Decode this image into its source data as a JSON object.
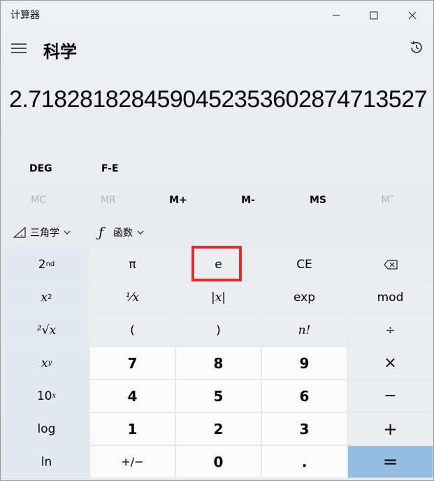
{
  "app_title": "计算器",
  "mode": "科学",
  "display_value": "2.7182818284590452353602874713527",
  "angle_unit": "DEG",
  "fe_label": "F-E",
  "memory": [
    {
      "label": "MC",
      "enabled": false
    },
    {
      "label": "MR",
      "enabled": false
    },
    {
      "label": "M+",
      "enabled": true
    },
    {
      "label": "M-",
      "enabled": true
    },
    {
      "label": "MS",
      "enabled": true
    },
    {
      "label": "M˅",
      "enabled": false
    }
  ],
  "dropdowns": {
    "trig_label": "三角学",
    "func_label": "函数"
  },
  "keys": {
    "second": "2",
    "second_sup": "nd",
    "pi": "π",
    "e": "e",
    "ce": "CE",
    "x_sq": "x",
    "x_sq_sup": "2",
    "reciprocal": "⅟x",
    "abs": "|x|",
    "exp": "exp",
    "mod": "mod",
    "sqrt": "²√x",
    "lparen": "(",
    "rparen": ")",
    "fact": "n!",
    "divide": "÷",
    "x_pow": "x",
    "x_pow_sup": "y",
    "seven": "7",
    "eight": "8",
    "nine": "9",
    "times": "×",
    "ten_pow": "10",
    "ten_pow_sup": "x",
    "four": "4",
    "five": "5",
    "six": "6",
    "minus": "−",
    "log": "log",
    "one": "1",
    "two": "2",
    "three": "3",
    "plus": "+",
    "ln": "ln",
    "negate": "+/−",
    "zero": "0",
    "decimal": ".",
    "equals": "="
  },
  "colors": {
    "equals_bg": "#94bde2",
    "highlight": "#e02e2e"
  }
}
